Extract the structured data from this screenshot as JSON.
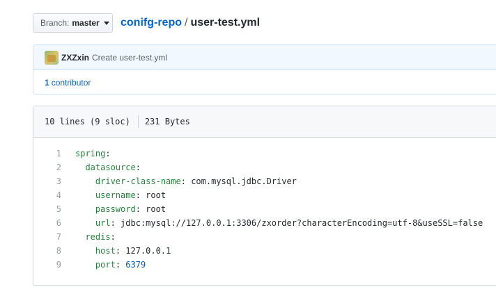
{
  "branch": {
    "prefix": "Branch:",
    "name": "master"
  },
  "breadcrumb": {
    "repo": "conifg-repo",
    "separator": "/",
    "file": "user-test.yml"
  },
  "commit": {
    "author": "ZXZxin",
    "message": "Create user-test.yml"
  },
  "contributors": {
    "count": "1",
    "label": "contributor"
  },
  "file_info": {
    "lines": "10 lines (9 sloc)",
    "size": "231 Bytes"
  },
  "code_lines": [
    {
      "num": "1",
      "indent": "",
      "key": "spring",
      "colon": ":",
      "value": "",
      "value_type": "str"
    },
    {
      "num": "2",
      "indent": "  ",
      "key": "datasource",
      "colon": ":",
      "value": "",
      "value_type": "str"
    },
    {
      "num": "3",
      "indent": "    ",
      "key": "driver-class-name",
      "colon": ":",
      "value": " com.mysql.jdbc.Driver",
      "value_type": "str"
    },
    {
      "num": "4",
      "indent": "    ",
      "key": "username",
      "colon": ":",
      "value": " root",
      "value_type": "str"
    },
    {
      "num": "5",
      "indent": "    ",
      "key": "password",
      "colon": ":",
      "value": " root",
      "value_type": "str"
    },
    {
      "num": "6",
      "indent": "    ",
      "key": "url",
      "colon": ":",
      "value": " jdbc:mysql://127.0.0.1:3306/zxorder?characterEncoding=utf-8&useSSL=false",
      "value_type": "str"
    },
    {
      "num": "7",
      "indent": "  ",
      "key": "redis",
      "colon": ":",
      "value": "",
      "value_type": "str"
    },
    {
      "num": "8",
      "indent": "    ",
      "key": "host",
      "colon": ":",
      "value": " 127.0.0.1",
      "value_type": "str"
    },
    {
      "num": "9",
      "indent": "    ",
      "key": "port",
      "colon": ":",
      "value": " 6379",
      "value_type": "num"
    }
  ],
  "colors": {
    "link": "#0366d6",
    "yaml_key": "#22863a",
    "yaml_number": "#005cc5",
    "commit_bg": "#f1f8ff"
  }
}
